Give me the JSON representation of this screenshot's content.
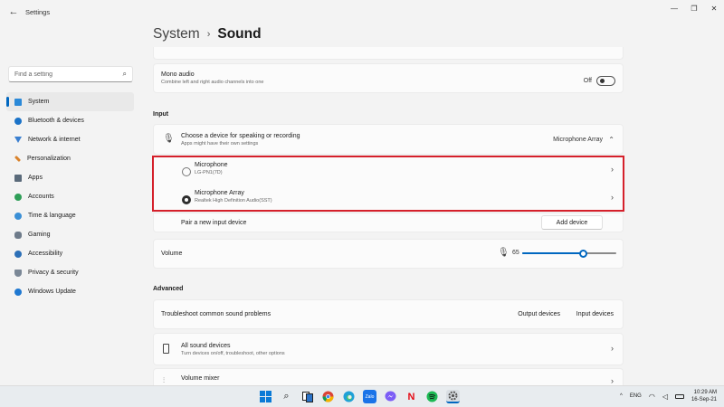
{
  "window": {
    "back_glyph": "←",
    "title": "Settings",
    "controls": [
      "—",
      "❐",
      "✕"
    ]
  },
  "sidebar": {
    "search_placeholder": "Find a setting",
    "items": [
      {
        "label": "System",
        "icon": "system-icon",
        "active": true
      },
      {
        "label": "Bluetooth & devices",
        "icon": "bluetooth-icon"
      },
      {
        "label": "Network & internet",
        "icon": "network-icon"
      },
      {
        "label": "Personalization",
        "icon": "brush-icon"
      },
      {
        "label": "Apps",
        "icon": "apps-icon"
      },
      {
        "label": "Accounts",
        "icon": "accounts-icon"
      },
      {
        "label": "Time & language",
        "icon": "globe-icon"
      },
      {
        "label": "Gaming",
        "icon": "gamepad-icon"
      },
      {
        "label": "Accessibility",
        "icon": "accessibility-icon"
      },
      {
        "label": "Privacy & security",
        "icon": "shield-icon"
      },
      {
        "label": "Windows Update",
        "icon": "update-icon"
      }
    ]
  },
  "breadcrumb": {
    "parent": "System",
    "separator": "›",
    "current": "Sound"
  },
  "mono_audio": {
    "title": "Mono audio",
    "subtitle": "Combine left and right audio channels into one",
    "state_label": "Off"
  },
  "input": {
    "section_label": "Input",
    "choose_device": {
      "title": "Choose a device for speaking or recording",
      "subtitle": "Apps might have their own settings",
      "selected": "Microphone Array",
      "expand_glyph": "⌃"
    },
    "devices": [
      {
        "name": "Microphone",
        "detail": "LG-PN1(7D)",
        "selected": false
      },
      {
        "name": "Microphone Array",
        "detail": "Realtek High Definition Audio(SST)",
        "selected": true
      }
    ],
    "pair_label": "Pair a new input device",
    "add_device_button": "Add device",
    "volume_label": "Volume",
    "volume_value": "65",
    "volume_level": 0.65
  },
  "advanced": {
    "section_label": "Advanced",
    "troubleshoot": {
      "title": "Troubleshoot common sound problems",
      "output_button": "Output devices",
      "input_button": "Input devices"
    },
    "all_devices": {
      "title": "All sound devices",
      "subtitle": "Turn devices on/off, troubleshoot, other options"
    },
    "volume_mixer": {
      "title": "Volume mixer"
    }
  },
  "taskbar": {
    "apps": [
      "windows-start-icon",
      "search-icon",
      "task-view-icon",
      "chrome-icon",
      "edge-icon",
      "zalo-icon",
      "messenger-icon",
      "netflix-icon",
      "spotify-icon",
      "settings-icon"
    ],
    "zalo_text": "Zalo",
    "netflix_text": "N",
    "tray": {
      "chevron": "^",
      "language": "ENG",
      "time": "10:29 AM",
      "date": "16-Sep-21"
    }
  },
  "colors": {
    "accent": "#0067c0",
    "highlight_border": "#d5202b",
    "background": "#f3f3f3"
  }
}
